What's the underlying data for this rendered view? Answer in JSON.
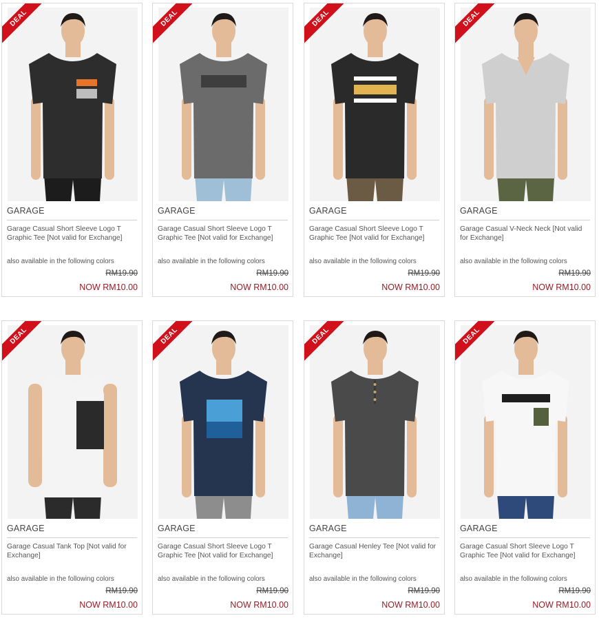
{
  "colors": {
    "deal_ribbon": "#d0101b",
    "sale_price": "#9b1b26",
    "card_border": "#d9d9d9"
  },
  "products": [
    {
      "badge": "DEAL",
      "brand": "GARAGE",
      "name": "Garage Casual Short Sleeve Logo T Graphic Tee [Not valid for Exchange]",
      "colors_note": "also available in the following colors",
      "old_price": "RM19.90",
      "new_price": "NOW RM10.00",
      "tee_color": "#2d2d2d",
      "pants_color": "#1c1c1c",
      "print": "TRUTH",
      "print_color": "#e8742a",
      "garment": "tee"
    },
    {
      "badge": "DEAL",
      "brand": "GARAGE",
      "name": "Garage Casual Short Sleeve Logo T Graphic Tee [Not valid for Exchange]",
      "colors_note": "also available in the following colors",
      "old_price": "RM19.90",
      "new_price": "NOW RM10.00",
      "tee_color": "#6b6b6b",
      "pants_color": "#9fbfd6",
      "print": "SALE",
      "print_color": "#3e3e3e",
      "garment": "tee"
    },
    {
      "badge": "DEAL",
      "brand": "GARAGE",
      "name": "Garage Casual Short Sleeve Logo T Graphic Tee [Not valid for Exchange]",
      "colors_note": "also available in the following colors",
      "old_price": "RM19.90",
      "new_price": "NOW RM10.00",
      "tee_color": "#2a2a2a",
      "pants_color": "#6b5a44",
      "print": "CREATE YOUR FUTURE",
      "print_color": "#e2b451",
      "garment": "tee"
    },
    {
      "badge": "DEAL",
      "brand": "GARAGE",
      "name": "Garage Casual V-Neck Neck [Not valid for Exchange]",
      "colors_note": "also available in the following colors",
      "old_price": "RM19.90",
      "new_price": "NOW RM10.00",
      "tee_color": "#cfcfcf",
      "pants_color": "#5b6443",
      "print": "",
      "print_color": "#cfcfcf",
      "garment": "vneck"
    },
    {
      "badge": "DEAL",
      "brand": "GARAGE",
      "name": "Garage Casual Tank Top [Not valid for Exchange]",
      "colors_note": "also available in the following colors",
      "old_price": "RM19.90",
      "new_price": "NOW RM10.00",
      "tee_color": "#f4f4f4",
      "pants_color": "#2b2b2b",
      "print": "NOTHING LAST FOREVER",
      "print_color": "#2a2a2a",
      "garment": "tank"
    },
    {
      "badge": "DEAL",
      "brand": "GARAGE",
      "name": "Garage Casual Short Sleeve Logo T Graphic Tee [Not valid for Exchange]",
      "colors_note": "also available in the following colors",
      "old_price": "RM19.90",
      "new_price": "NOW RM10.00",
      "tee_color": "#25344f",
      "pants_color": "#8d8d8d",
      "print": "CITY",
      "print_color": "#4a9fd6",
      "garment": "tee"
    },
    {
      "badge": "DEAL",
      "brand": "GARAGE",
      "name": "Garage Casual Henley Tee [Not valid for Exchange]",
      "colors_note": "also available in the following colors",
      "old_price": "RM19.90",
      "new_price": "NOW RM10.00",
      "tee_color": "#4a4a4a",
      "pants_color": "#8fb3d4",
      "print": "",
      "print_color": "#4a4a4a",
      "garment": "henley"
    },
    {
      "badge": "DEAL",
      "brand": "GARAGE",
      "name": "Garage Casual Short Sleeve Logo T Graphic Tee [Not valid for Exchange]",
      "colors_note": "also available in the following colors",
      "old_price": "RM19.90",
      "new_price": "NOW RM10.00",
      "tee_color": "#f7f7f7",
      "pants_color": "#2e4a7a",
      "print": "SOLDIER",
      "print_color": "#1e1e1e",
      "garment": "pocket"
    }
  ]
}
